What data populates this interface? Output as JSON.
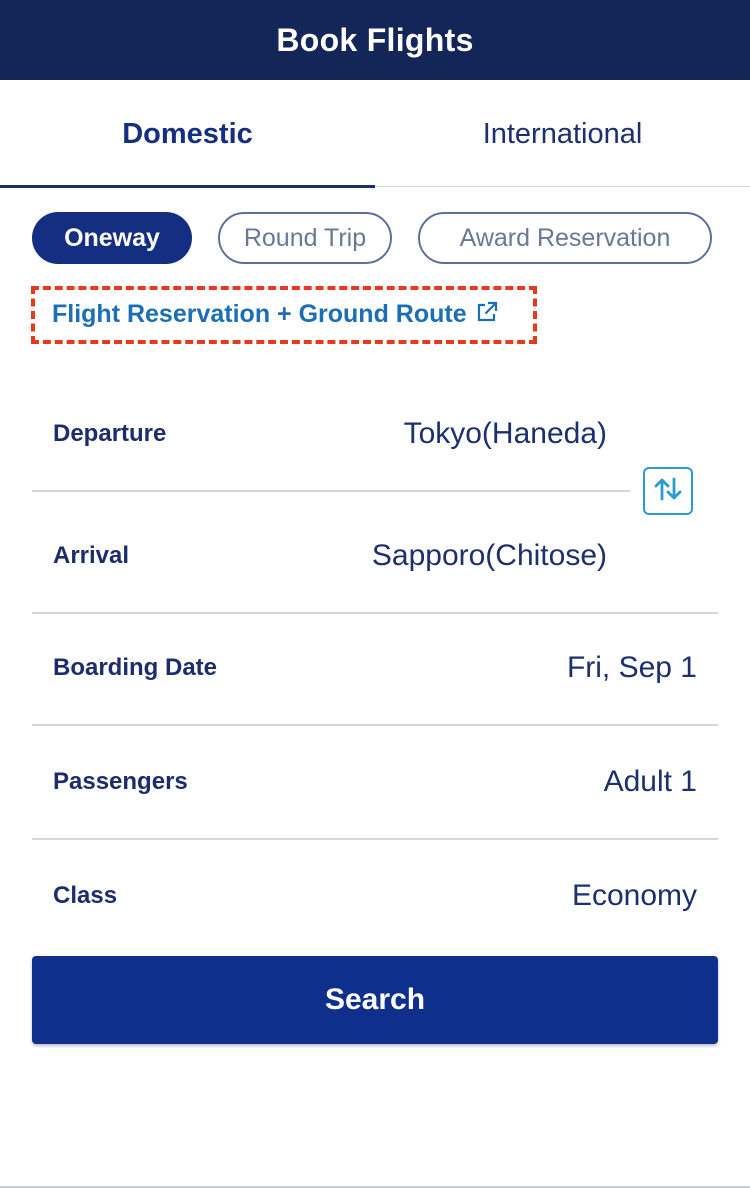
{
  "header": {
    "title": "Book Flights"
  },
  "tabs": [
    {
      "label": "Domestic",
      "active": true
    },
    {
      "label": "International",
      "active": false
    }
  ],
  "trip_types": [
    {
      "label": "Oneway",
      "selected": true
    },
    {
      "label": "Round Trip",
      "selected": false
    },
    {
      "label": "Award Reservation",
      "selected": false
    }
  ],
  "ground_route": {
    "label": "Flight Reservation + Ground Route",
    "icon": "external-link-icon"
  },
  "form": {
    "departure": {
      "label": "Departure",
      "value": "Tokyo(Haneda)"
    },
    "arrival": {
      "label": "Arrival",
      "value": "Sapporo(Chitose)"
    },
    "boarding_date": {
      "label": "Boarding Date",
      "value": "Fri, Sep 1"
    },
    "passengers": {
      "label": "Passengers",
      "value": "Adult 1"
    },
    "class": {
      "label": "Class",
      "value": "Economy"
    }
  },
  "swap_icon": "swap-vertical-arrows-icon",
  "search_button": {
    "label": "Search"
  },
  "colors": {
    "header_bg": "#142558",
    "primary": "#142f82",
    "button_bg": "#0f2f8c",
    "link": "#1c6fb5",
    "highlight_border": "#e8391e",
    "swap_icon": "#2a9bd4"
  }
}
